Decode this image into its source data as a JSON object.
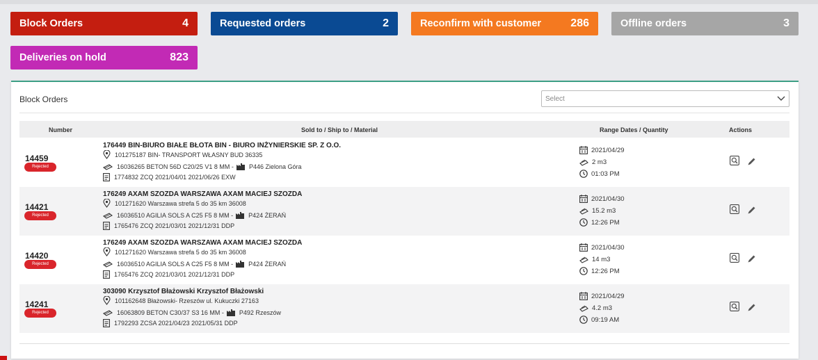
{
  "tiles": [
    {
      "label": "Block Orders",
      "count": "4",
      "color": "#c41e10"
    },
    {
      "label": "Requested orders",
      "count": "2",
      "color": "#0a4a93"
    },
    {
      "label": "Reconfirm with customer",
      "count": "286",
      "color": "#f47920"
    },
    {
      "label": "Offline orders",
      "count": "3",
      "color": "#a6a6a6"
    },
    {
      "label": "Deliveries on hold",
      "count": "823",
      "color": "#c22ab5"
    }
  ],
  "panel": {
    "title": "Block Orders",
    "select_placeholder": "Select",
    "columns": {
      "number": "Number",
      "sold_ship_material": "Sold to / Ship to / Material",
      "range_quantity": "Range Dates / Quantity",
      "actions": "Actions"
    }
  },
  "orders": [
    {
      "number": "14459",
      "status": "Rejected",
      "sold_to": "176449 BIN-BIURO BIAŁE BŁOTA BIN - BIURO INŻYNIERSKIE SP. Z O.O.",
      "ship_to": "101275187 BIN- TRANSPORT WŁASNY BUD 36335",
      "material": "16036265 BETON 56D C20/25 V1 8 MM -",
      "plant": "P446 Zielona Góra",
      "contract": "1774832 ZCQ 2021/04/01 2021/06/26 EXW",
      "date": "2021/04/29",
      "quantity": "2 m3",
      "time": "01:03 PM"
    },
    {
      "number": "14421",
      "status": "Rejected",
      "sold_to": "176249 AXAM SZOZDA WARSZAWA AXAM MACIEJ SZOZDA",
      "ship_to": "101271620 Warszawa strefa 5 do 35 km 36008",
      "material": "16036510 AGILIA SOLS A C25 F5 8 MM -",
      "plant": "P424 ŻERAŃ",
      "contract": "1765476 ZCQ 2021/03/01 2021/12/31 DDP",
      "date": "2021/04/30",
      "quantity": "15.2 m3",
      "time": "12:26 PM"
    },
    {
      "number": "14420",
      "status": "Rejected",
      "sold_to": "176249 AXAM SZOZDA WARSZAWA AXAM MACIEJ SZOZDA",
      "ship_to": "101271620 Warszawa strefa 5 do 35 km 36008",
      "material": "16036510 AGILIA SOLS A C25 F5 8 MM -",
      "plant": "P424 ŻERAŃ",
      "contract": "1765476 ZCQ 2021/03/01 2021/12/31 DDP",
      "date": "2021/04/30",
      "quantity": "14 m3",
      "time": "12:26 PM"
    },
    {
      "number": "14241",
      "status": "Rejected",
      "sold_to": "303090 Krzysztof Błażowski Krzysztof Błażowski",
      "ship_to": "101162648 Błażowski- Rzeszów ul. Kukuczki 27163",
      "material": "16063809 BETON C30/37 S3 16 MM -",
      "plant": "P492 Rzeszów",
      "contract": "1792293 ZCSA 2021/04/23 2021/05/31 DDP",
      "date": "2021/04/29",
      "quantity": "4.2 m3",
      "time": "09:19 AM"
    }
  ],
  "icons": {
    "ship_to": "location-pin-icon",
    "material": "truck-icon",
    "plant": "factory-icon",
    "contract": "document-icon",
    "date": "calendar-icon",
    "quantity": "mixer-icon",
    "time": "clock-icon",
    "view": "search-icon",
    "edit": "pencil-icon"
  }
}
